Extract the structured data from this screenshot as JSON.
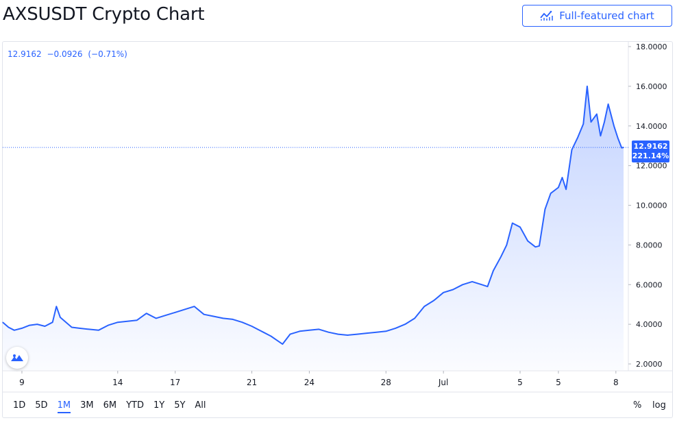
{
  "header": {
    "title": "AXSUSDT Crypto Chart",
    "full_chart_label": "Full-featured chart"
  },
  "legend": {
    "last": "12.9162",
    "change": "−0.0926",
    "change_pct": "(−0.71%)"
  },
  "price_tag": {
    "price": "12.9162",
    "pct": "221.14%"
  },
  "range_buttons": [
    "1D",
    "5D",
    "1M",
    "3M",
    "6M",
    "YTD",
    "1Y",
    "5Y",
    "All"
  ],
  "active_range": "1M",
  "options": {
    "percent": "%",
    "log": "log"
  },
  "colors": {
    "line": "#2962ff",
    "accent": "#2962ff",
    "axis_text": "#131722",
    "border": "#e0e3eb"
  },
  "chart_data": {
    "type": "area",
    "title": "",
    "xlabel": "",
    "ylabel": "",
    "ylim": [
      1.5,
      18.2
    ],
    "y_ticks": [
      "2.0000",
      "4.0000",
      "6.0000",
      "8.0000",
      "10.0000",
      "12.0000",
      "14.0000",
      "16.0000",
      "18.0000"
    ],
    "x_ticks": [
      {
        "label": "9",
        "x": 9.0
      },
      {
        "label": "14",
        "x": 14.0
      },
      {
        "label": "17",
        "x": 17.0
      },
      {
        "label": "21",
        "x": 21.0
      },
      {
        "label": "24",
        "x": 24.0
      },
      {
        "label": "28",
        "x": 28.0
      },
      {
        "label": "Jul",
        "x": 31.0
      },
      {
        "label": "5",
        "x": 35.0
      },
      {
        "label": "5",
        "x": 37.0
      },
      {
        "label": "8",
        "x": 40.0
      }
    ],
    "x_range": [
      8.0,
      40.5
    ],
    "series": [
      {
        "x": [
          8.0,
          8.3,
          8.6,
          9.0,
          9.4,
          9.8,
          10.2,
          10.6,
          10.8,
          11.0,
          11.3,
          11.6,
          12.0,
          12.5,
          13.0,
          13.5,
          14.0,
          14.5,
          15.0,
          15.5,
          16.0,
          16.5,
          17.0,
          17.5,
          18.0,
          18.5,
          19.0,
          19.5,
          20.0,
          20.5,
          21.0,
          21.3,
          21.6,
          22.0,
          22.3,
          22.6,
          23.0,
          23.5,
          24.0,
          24.5,
          25.0,
          25.5,
          26.0,
          26.5,
          27.0,
          27.5,
          28.0,
          28.5,
          29.0,
          29.5,
          30.0,
          30.5,
          31.0,
          31.5,
          32.0,
          32.5,
          33.0,
          33.3,
          33.6,
          34.0,
          34.3,
          34.6,
          35.0,
          35.4,
          35.8,
          36.0,
          36.3,
          36.6,
          37.0,
          37.2,
          37.4,
          37.7,
          38.0,
          38.3,
          38.5,
          38.7,
          39.0,
          39.2,
          39.4,
          39.6,
          39.9,
          40.1,
          40.3,
          40.4
        ],
        "y": [
          4.1,
          3.85,
          3.7,
          3.8,
          3.95,
          4.0,
          3.9,
          4.1,
          4.9,
          4.35,
          4.1,
          3.85,
          3.8,
          3.75,
          3.7,
          3.95,
          4.1,
          4.15,
          4.2,
          4.55,
          4.3,
          4.45,
          4.6,
          4.75,
          4.9,
          4.5,
          4.4,
          4.3,
          4.25,
          4.1,
          3.9,
          3.75,
          3.6,
          3.4,
          3.2,
          3.0,
          3.5,
          3.65,
          3.7,
          3.75,
          3.6,
          3.5,
          3.45,
          3.5,
          3.55,
          3.6,
          3.65,
          3.8,
          4.0,
          4.3,
          4.9,
          5.2,
          5.6,
          5.75,
          6.0,
          6.15,
          6.0,
          5.9,
          6.7,
          7.4,
          8.0,
          9.1,
          8.9,
          8.2,
          7.9,
          7.95,
          9.8,
          10.6,
          10.9,
          11.4,
          10.8,
          12.8,
          13.4,
          14.1,
          16.0,
          14.2,
          14.6,
          13.5,
          14.2,
          15.1,
          14.0,
          13.4,
          12.9,
          12.9162
        ]
      }
    ]
  }
}
